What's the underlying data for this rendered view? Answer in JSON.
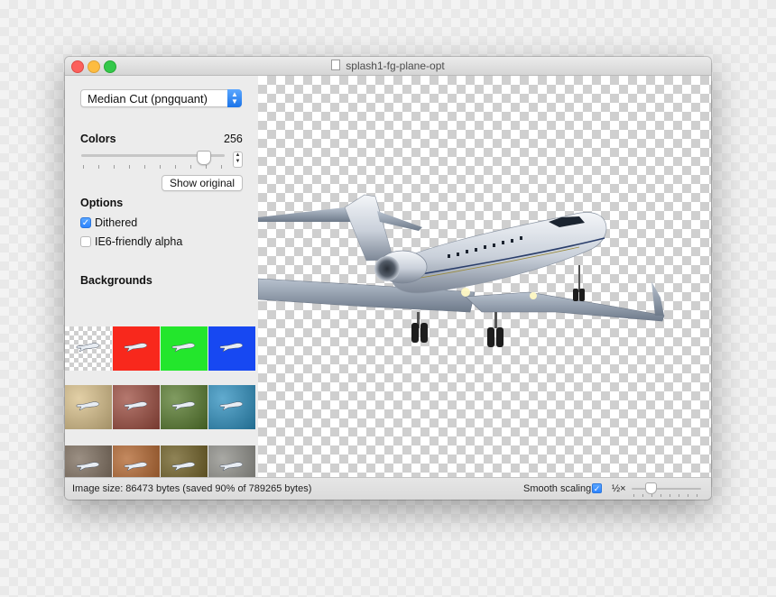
{
  "window": {
    "title": "splash1-fg-plane-opt"
  },
  "sidebar": {
    "algorithm": {
      "selected": "Median Cut (pngquant)"
    },
    "colors": {
      "label": "Colors",
      "value": "256",
      "level_fraction": 1.0
    },
    "show_original_label": "Show original",
    "options": {
      "label": "Options",
      "dithered": {
        "label": "Dithered",
        "checked": true
      },
      "ie6_alpha": {
        "label": "IE6-friendly alpha",
        "checked": false
      }
    },
    "backgrounds": {
      "label": "Backgrounds",
      "swatches": [
        {
          "kind": "checker",
          "color": "#ffffff"
        },
        {
          "kind": "solid",
          "color": "#f8281c"
        },
        {
          "kind": "solid",
          "color": "#23e62c"
        },
        {
          "kind": "solid",
          "color": "#1748f2"
        },
        {
          "kind": "texture",
          "color": "#d9c089"
        },
        {
          "kind": "texture",
          "color": "#9c4b3e"
        },
        {
          "kind": "texture",
          "color": "#567a2c"
        },
        {
          "kind": "texture",
          "color": "#2c8fbf"
        },
        {
          "kind": "texture",
          "color": "#7a6a5a"
        },
        {
          "kind": "texture",
          "color": "#b0622a"
        },
        {
          "kind": "texture",
          "color": "#6a5a1e"
        },
        {
          "kind": "texture",
          "color": "#8c8c86"
        }
      ]
    }
  },
  "statusbar": {
    "image_size_text": "Image size: 86473 bytes (saved 90% of 789265 bytes)",
    "smooth_scaling": {
      "label": "Smooth scaling",
      "checked": true
    },
    "zoom_label": "½×"
  },
  "icons": [
    "document-icon",
    "popup-arrows-icon",
    "stepper-icon",
    "checkmark-icon",
    "airplane-icon"
  ]
}
